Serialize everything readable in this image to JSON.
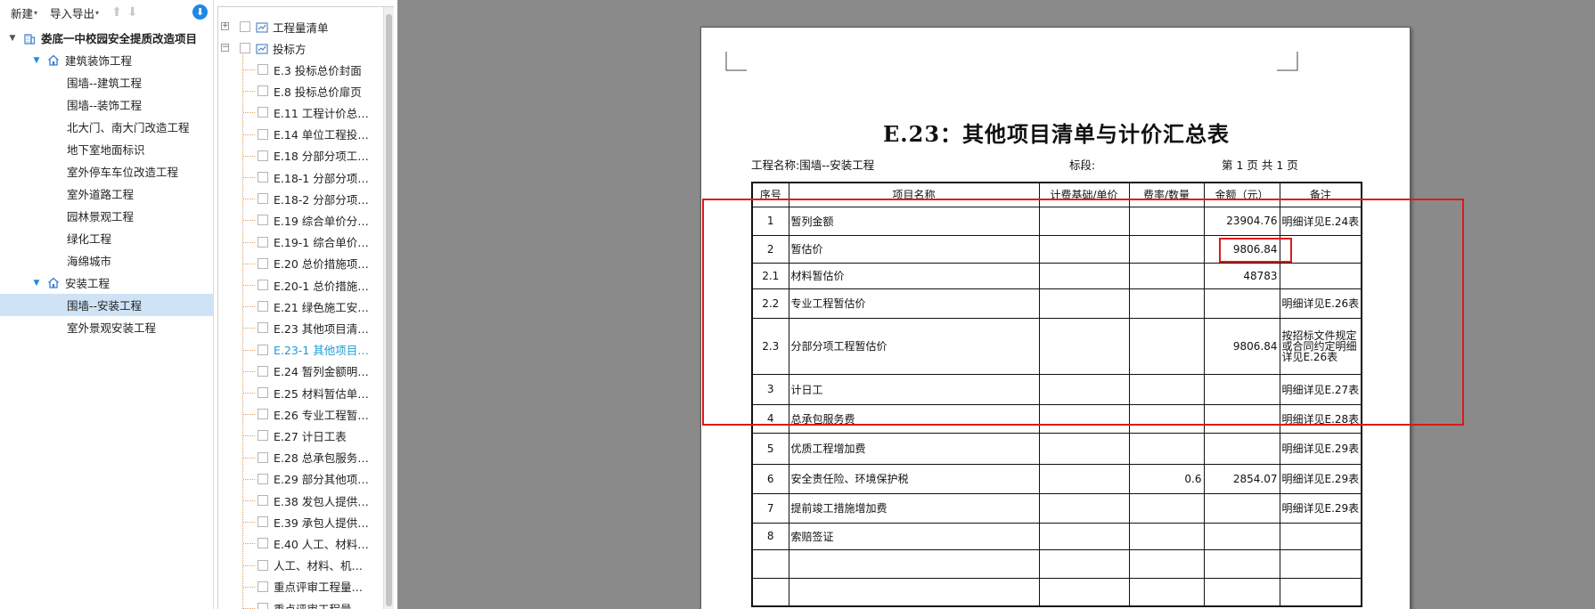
{
  "toolbar": {
    "new_label": "新建",
    "import_export_label": "导入导出"
  },
  "project_tree": {
    "root": "娄底一中校园安全提质改造项目",
    "groups": [
      {
        "name": "建筑装饰工程",
        "items": [
          "围墙--建筑工程",
          "围墙--装饰工程",
          "北大门、南大门改造工程",
          "地下室地面标识",
          "室外停车车位改造工程",
          "室外道路工程",
          "园林景观工程",
          "绿化工程",
          "海绵城市"
        ]
      },
      {
        "name": "安装工程",
        "items": [
          "围墙--安装工程",
          "室外景观安装工程"
        ]
      }
    ],
    "selected": "围墙--安装工程"
  },
  "report_list": {
    "top_nodes": [
      "工程量清单",
      "投标方"
    ],
    "items": [
      "E.3 投标总价封面",
      "E.8 投标总价扉页",
      "E.11 工程计价总…",
      "E.14 单位工程投…",
      "E.18 分部分项工…",
      "E.18-1 分部分项…",
      "E.18-2 分部分项…",
      "E.19 综合单价分…",
      "E.19-1 综合单价…",
      "E.20 总价措施项…",
      "E.20-1 总价措施…",
      "E.21 绿色施工安…",
      "E.23 其他项目清…",
      "E.23-1 其他项目…",
      "E.24 暂列金额明…",
      "E.25 材料暂估单…",
      "E.26 专业工程暂…",
      "E.27 计日工表",
      "E.28 总承包服务…",
      "E.29 部分其他项…",
      "E.38 发包人提供…",
      "E.39 承包人提供…",
      "E.40 人工、材料…",
      "人工、材料、机…",
      "重点评审工程量…",
      "重点评审工程量…"
    ],
    "active_index": 13
  },
  "document": {
    "title": "E.23：其他项目清单与计价汇总表",
    "project_label": "工程名称:",
    "project_name": "围墙--安装工程",
    "section_label": "标段:",
    "page_text": "第  1  页  共  1  页",
    "headers": [
      "序号",
      "项目名称",
      "计费基础/单价",
      "费率/数量",
      "金额（元）",
      "备注"
    ],
    "rows": [
      {
        "no": "1",
        "name": "暂列金额",
        "base": "",
        "rate": "",
        "amount": "23904.76",
        "remark": "明细详见E.24表"
      },
      {
        "no": "2",
        "name": "暂估价",
        "base": "",
        "rate": "",
        "amount": "9806.84",
        "remark": ""
      },
      {
        "no": "2.1",
        "name": "材料暂估价",
        "base": "",
        "rate": "",
        "amount": "48783",
        "remark": ""
      },
      {
        "no": "2.2",
        "name": "专业工程暂估价",
        "base": "",
        "rate": "",
        "amount": "",
        "remark": "明细详见E.26表"
      },
      {
        "no": "2.3",
        "name": "分部分项工程暂估价",
        "base": "",
        "rate": "",
        "amount": "9806.84",
        "remark": "按招标文件规定或合同约定明细详见E.26表"
      },
      {
        "no": "3",
        "name": "计日工",
        "base": "",
        "rate": "",
        "amount": "",
        "remark": "明细详见E.27表"
      },
      {
        "no": "4",
        "name": "总承包服务费",
        "base": "",
        "rate": "",
        "amount": "",
        "remark": "明细详见E.28表"
      },
      {
        "no": "5",
        "name": "优质工程增加费",
        "base": "",
        "rate": "",
        "amount": "",
        "remark": "明细详见E.29表"
      },
      {
        "no": "6",
        "name": "安全责任险、环境保护税",
        "base": "",
        "rate": "0.6",
        "amount": "2854.07",
        "remark": "明细详见E.29表"
      },
      {
        "no": "7",
        "name": "提前竣工措施增加费",
        "base": "",
        "rate": "",
        "amount": "",
        "remark": "明细详见E.29表"
      },
      {
        "no": "8",
        "name": "索赔签证",
        "base": "",
        "rate": "",
        "amount": "",
        "remark": ""
      },
      {
        "no": "",
        "name": "",
        "base": "",
        "rate": "",
        "amount": "",
        "remark": ""
      },
      {
        "no": "",
        "name": "",
        "base": "",
        "rate": "",
        "amount": "",
        "remark": ""
      }
    ]
  },
  "colors": {
    "highlight": "#e01818",
    "selected_bg": "#cfe3f6",
    "active_text": "#1e9ad6",
    "canvas_bg": "#8a8a8a"
  }
}
